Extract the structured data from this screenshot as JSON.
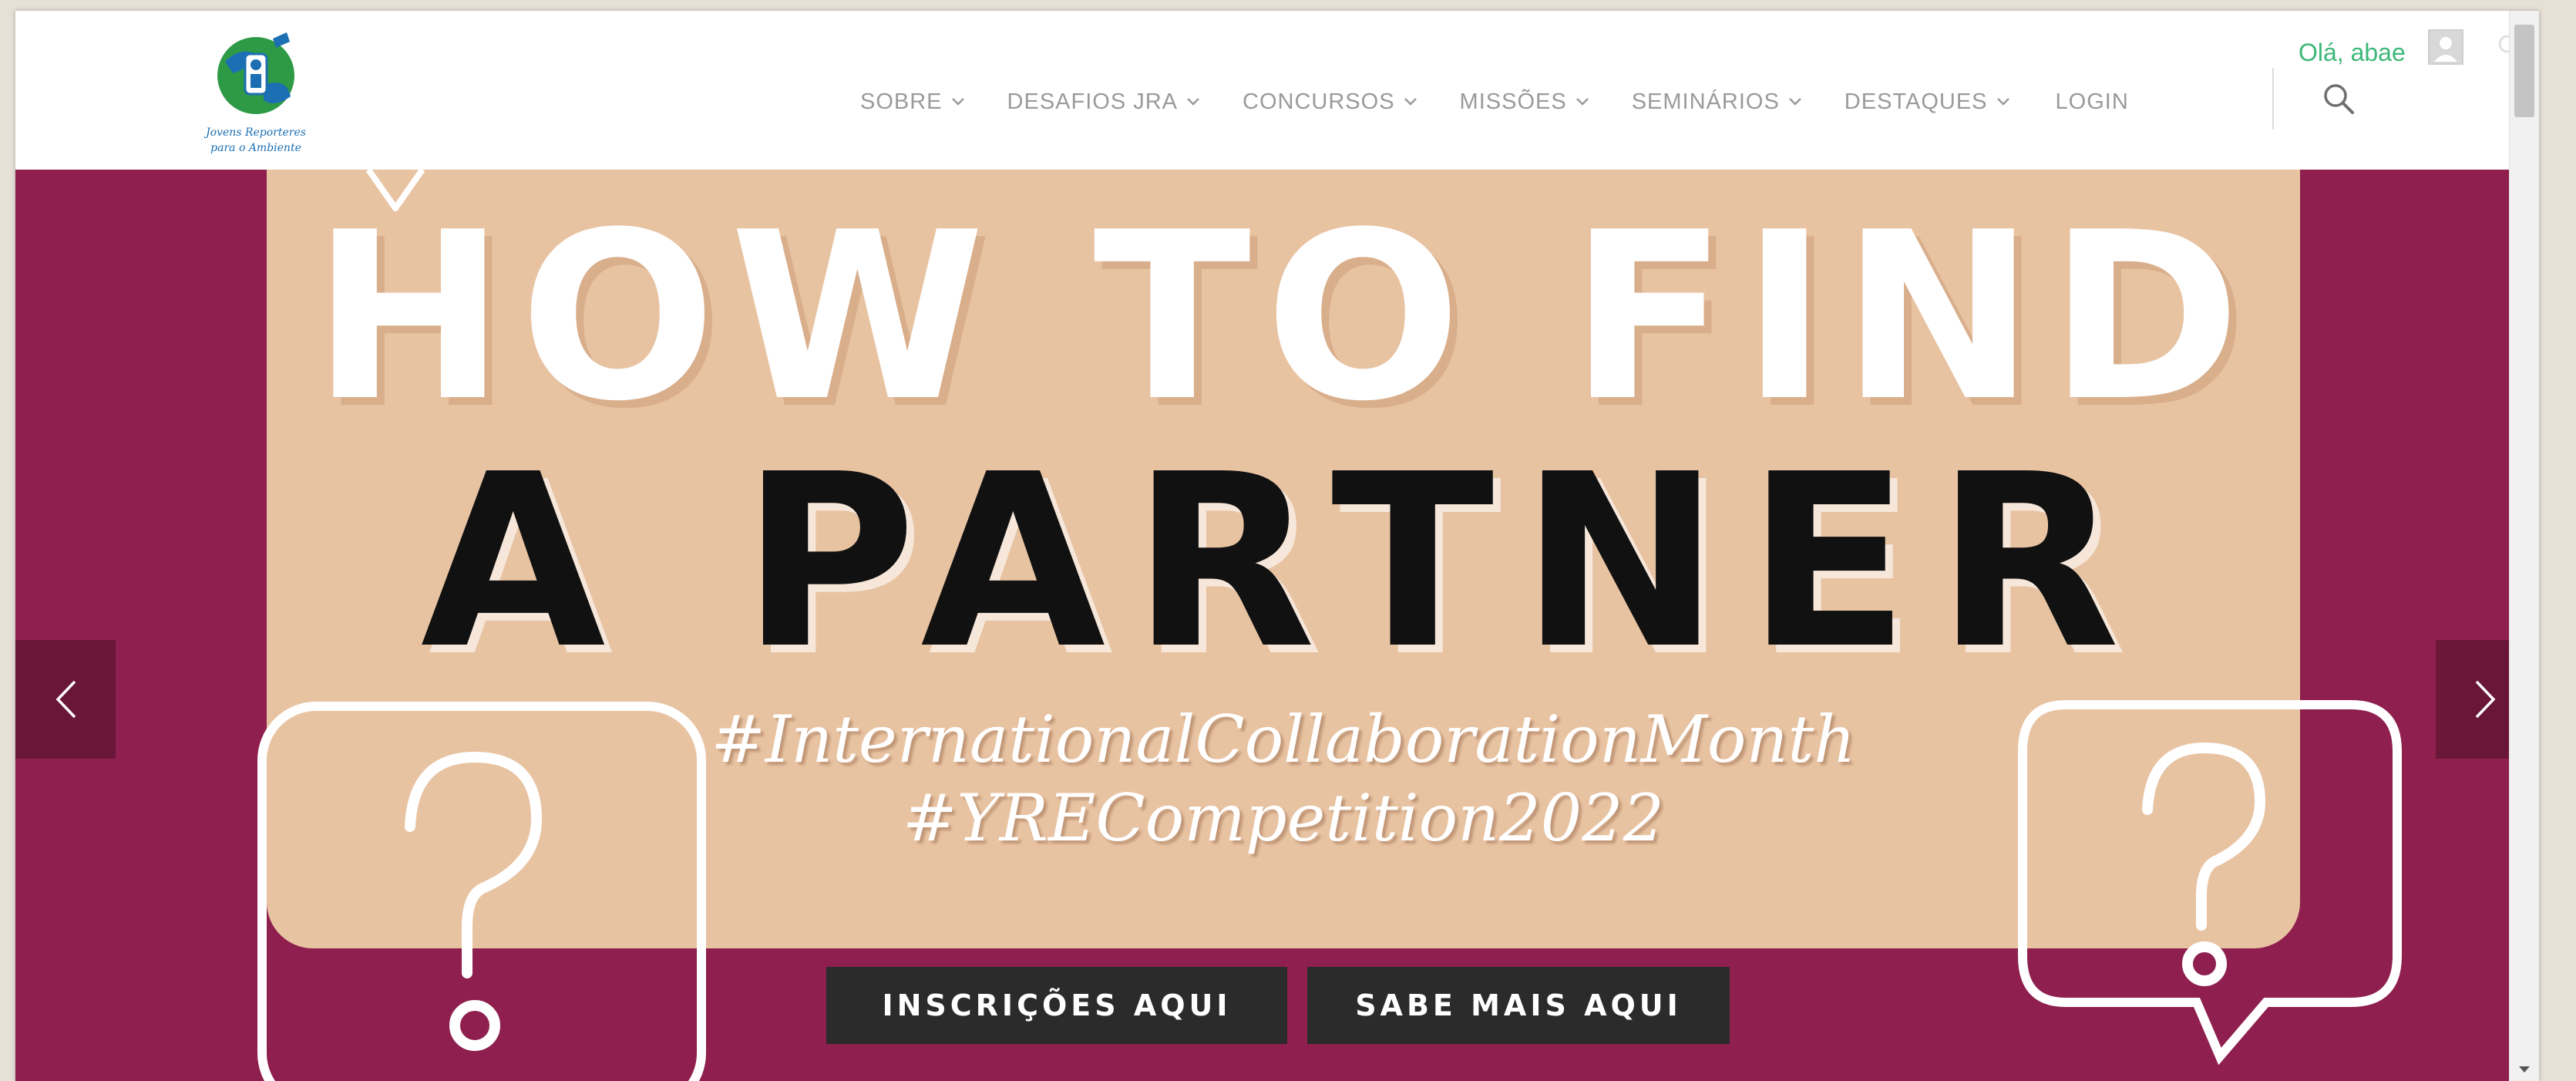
{
  "header": {
    "logo_lines": [
      "Jovens Reporteres",
      "para o Ambiente"
    ],
    "nav": [
      {
        "label": "SOBRE",
        "has_dropdown": true
      },
      {
        "label": "DESAFIOS JRA",
        "has_dropdown": true
      },
      {
        "label": "CONCURSOS",
        "has_dropdown": true
      },
      {
        "label": "MISSÕES",
        "has_dropdown": true
      },
      {
        "label": "SEMINÁRIOS",
        "has_dropdown": true
      },
      {
        "label": "DESTAQUES",
        "has_dropdown": true
      }
    ],
    "login_label": "LOGIN",
    "greeting": "Olá, abae",
    "search_icon": "search-icon"
  },
  "hero": {
    "line1": "HOW TO FIND",
    "line2": "A PARTNER",
    "hashtag1": "#InternationalCollaborationMonth",
    "hashtag2": "#YRECompetition2022",
    "cta1_label": "INSCRIÇÕES AQUI",
    "cta2_label": "SABE MAIS AQUI",
    "prev_icon": "chevron-left-icon",
    "next_icon": "chevron-right-icon"
  },
  "colors": {
    "hero_bg": "#8e1f4e",
    "panel": "#e8c3a2",
    "greeting": "#3cb878",
    "cta_bg": "#2b2b2b"
  }
}
